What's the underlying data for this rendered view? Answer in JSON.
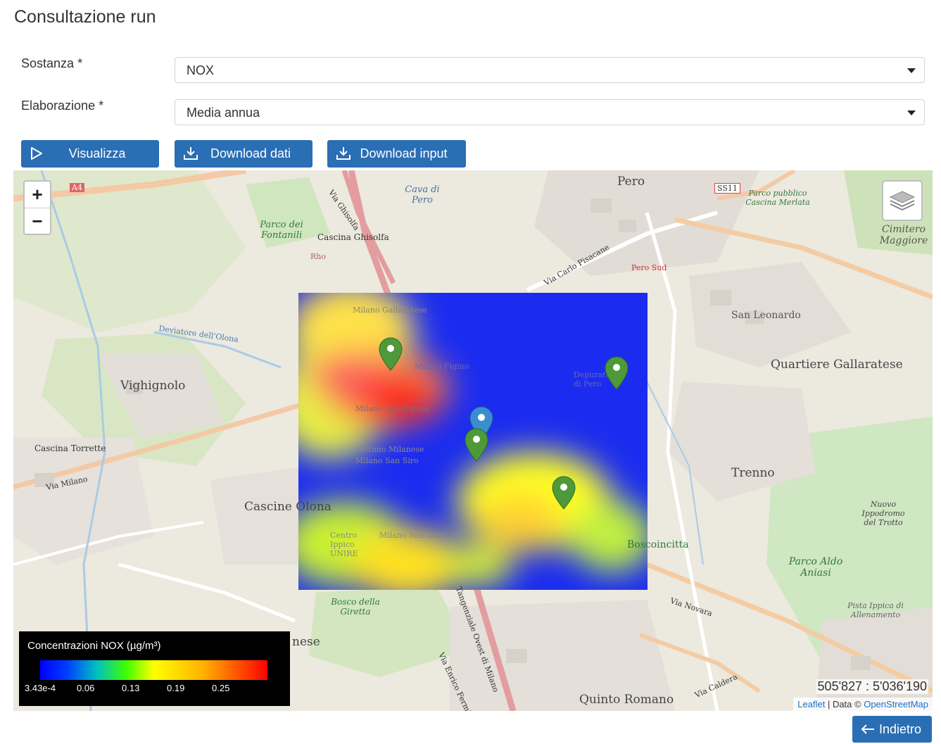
{
  "page": {
    "title": "Consultazione run"
  },
  "form": {
    "sostanza": {
      "label": "Sostanza",
      "required_mark": "*",
      "value": "NOX"
    },
    "elaborazione": {
      "label": "Elaborazione",
      "required_mark": "*",
      "value": "Media annua"
    }
  },
  "toolbar": {
    "visualizza_label": "Visualizza",
    "download_dati_label": "Download dati",
    "download_input_label": "Download input"
  },
  "map": {
    "zoom_in": "+",
    "zoom_out": "−",
    "labels": {
      "pero": "Pero",
      "ss11": "SS11",
      "a4": "A4",
      "cava_di_pero": "Cava di Pero",
      "parco_fontanili": "Parco dei Fontanili",
      "cascina_ghisolfa": "Cascina Ghisolfa",
      "via_ghisolfa": "Via Ghisolfa",
      "rho": "Rho",
      "parco_cascina_merlata": "Parco pubblico Cascina Merlata",
      "cimitero_maggiore": "Cimitero Maggiore",
      "pero_sud": "Pero Sud",
      "via_carlo_pisacane": "Via Carlo Pisacane",
      "san_leonardo": "San Leonardo",
      "quartiere_gallaratese": "Quartiere Gallaratese",
      "vighignolo": "Vighignolo",
      "deviatore_olona": "Deviatore dell'Olona",
      "cascina_torrette": "Cascina Torrette",
      "via_milano": "Via Milano",
      "cascine_olona": "Cascine Olona",
      "trenno": "Trenno",
      "nuovo_ippodromo": "Nuovo Ippodromo del Trotto",
      "parco_aldo_aniasi": "Parco Aldo Aniasi",
      "boscoincitta": "Boscoincitta",
      "via_novara": "Via Novara",
      "bosco_giretta": "Bosco della Giretta",
      "tangenziale_ovest": "Tangenziale Ovest di Milano",
      "via_enrico_fermi": "Via Enrico Fermi",
      "pista_ippica": "Pista Ippica di Allenamento",
      "quinto_romano": "Quinto Romano",
      "via_caldera": "Via Caldera",
      "settimo_milanese_suffix": "nese",
      "milano_gallaratese": "Milano Gallaratese",
      "milano_san_siro": "Milano San Siro",
      "settimo_milanese": "Settimo Milanese",
      "centro_ippico": "Centro Ippico UNIRE",
      "depuratore_pero": "Depuratore di Pero",
      "milano_figino": "Milano Figino"
    },
    "coordinates": "505'827 : 5'036'190",
    "attribution": {
      "leaflet": "Leaflet",
      "sep": "| Data ©",
      "osm": "OpenStreetMap"
    }
  },
  "legend": {
    "title": "Concentrazioni NOX (µg/m³)",
    "ticks": [
      "3.43e-4",
      "0.06",
      "0.13",
      "0.19",
      "0.25"
    ],
    "colors": [
      "#0000ff",
      "#00c0c0",
      "#40ff00",
      "#ffff00",
      "#ff0000"
    ]
  },
  "footer": {
    "back_label": "Indietro"
  },
  "colors": {
    "primary": "#2a6eb4",
    "marker_green": "#4e9a3a",
    "marker_blue": "#3a8ed0"
  }
}
